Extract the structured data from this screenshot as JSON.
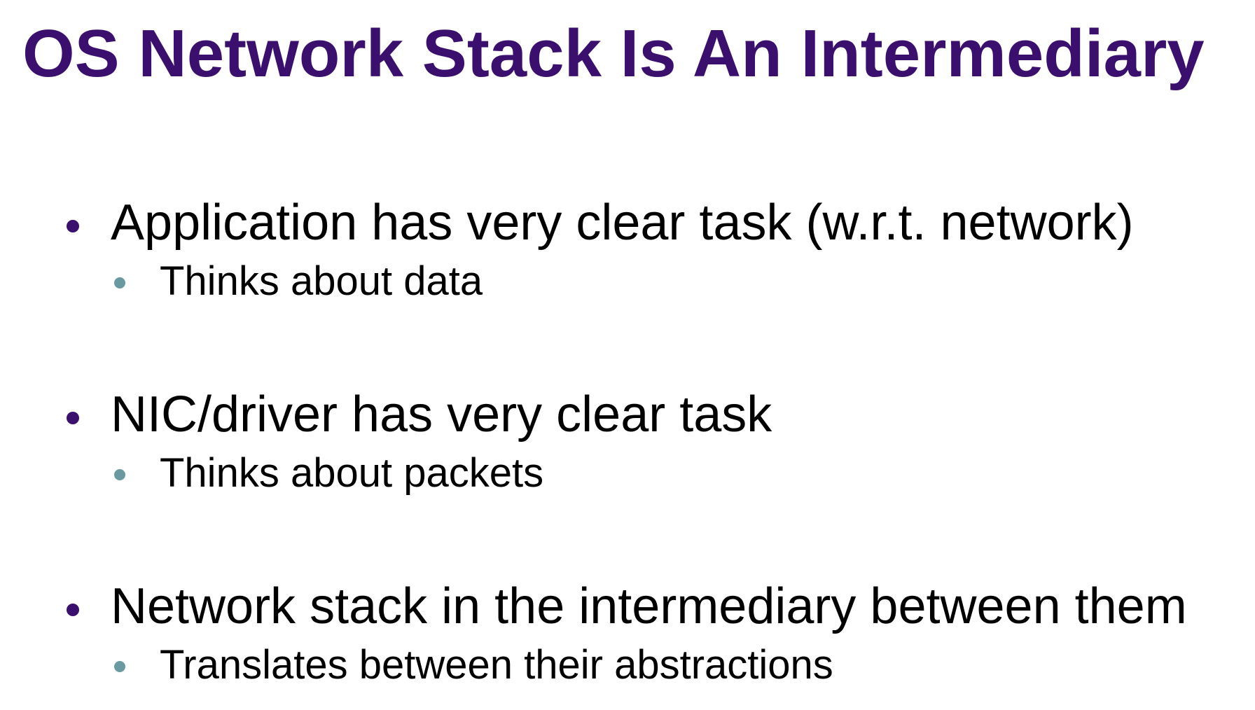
{
  "slide": {
    "title": "OS Network Stack Is An Intermediary",
    "title_color": "#3b0f6e",
    "bullet_color": "#3b0f6e",
    "sub_bullet_color": "#6a9aa0",
    "items": [
      {
        "text": "Application has very clear task (w.r.t. network)",
        "sub": "Thinks about data"
      },
      {
        "text": "NIC/driver has very clear task",
        "sub": "Thinks about packets"
      },
      {
        "text": "Network stack in the intermediary between them",
        "sub": "Translates between their abstractions"
      }
    ]
  }
}
